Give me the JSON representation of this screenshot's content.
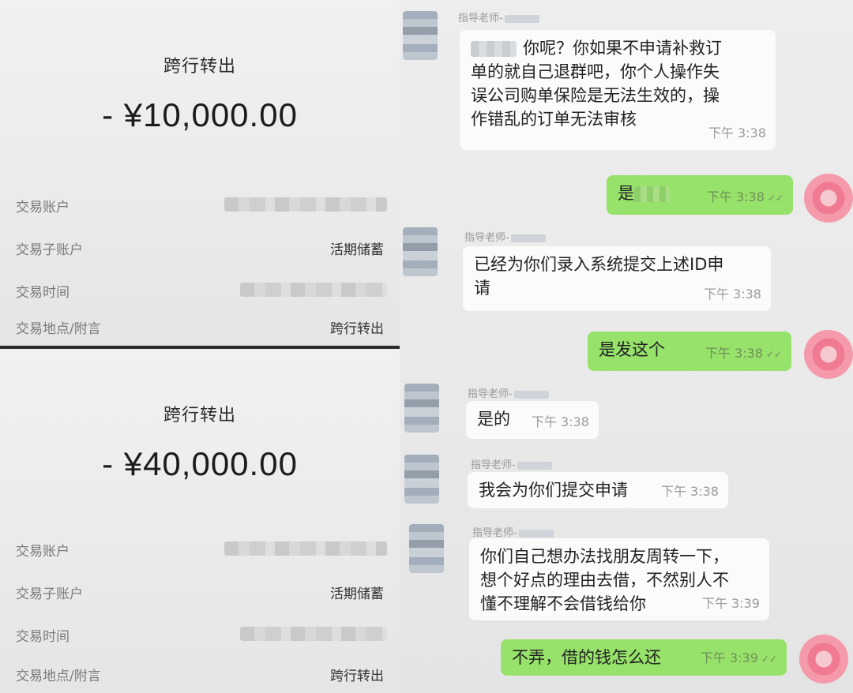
{
  "receipts": [
    {
      "title": "跨行转出",
      "amount": "- ¥10,000.00",
      "rows": [
        {
          "label": "交易账户",
          "value": ""
        },
        {
          "label": "交易子账户",
          "value": "活期储蓄"
        },
        {
          "label": "交易时间",
          "value": ""
        },
        {
          "label": "交易地点/附言",
          "value": "跨行转出"
        }
      ]
    },
    {
      "title": "跨行转出",
      "amount": "- ¥40,000.00",
      "rows": [
        {
          "label": "交易账户",
          "value": ""
        },
        {
          "label": "交易子账户",
          "value": "活期储蓄"
        },
        {
          "label": "交易时间",
          "value": ""
        },
        {
          "label": "交易地点/附言",
          "value": "跨行转出"
        }
      ]
    }
  ],
  "chat": {
    "sender_name": "指导老师-",
    "messages": [
      {
        "side": "in",
        "lines": [
          "你呢？你如果不申请补救订",
          "单的就自己退群吧，你个人操作失",
          "误公司购单保险是无法生效的，操",
          "作错乱的订单无法审核"
        ],
        "time": "下午 3:38"
      },
      {
        "side": "out",
        "lines": [
          "是"
        ],
        "time": "下午 3:38"
      },
      {
        "side": "in",
        "lines": [
          "已经为你们录入系统提交上述ID申",
          "请"
        ],
        "time": "下午 3:38"
      },
      {
        "side": "out",
        "lines": [
          "是发这个"
        ],
        "time": "下午 3:38"
      },
      {
        "side": "in",
        "lines": [
          "是的"
        ],
        "time": "下午 3:38"
      },
      {
        "side": "in",
        "lines": [
          "我会为你们提交申请"
        ],
        "time": "下午 3:38"
      },
      {
        "side": "in",
        "lines": [
          "你们自己想办法找朋友周转一下，",
          "想个好点的理由去借，不然别人不",
          "懂不理解不会借钱给你"
        ],
        "time": "下午 3:39"
      },
      {
        "side": "out",
        "lines": [
          "不弄，借的钱怎么还"
        ],
        "time": "下午 3:39"
      }
    ]
  }
}
